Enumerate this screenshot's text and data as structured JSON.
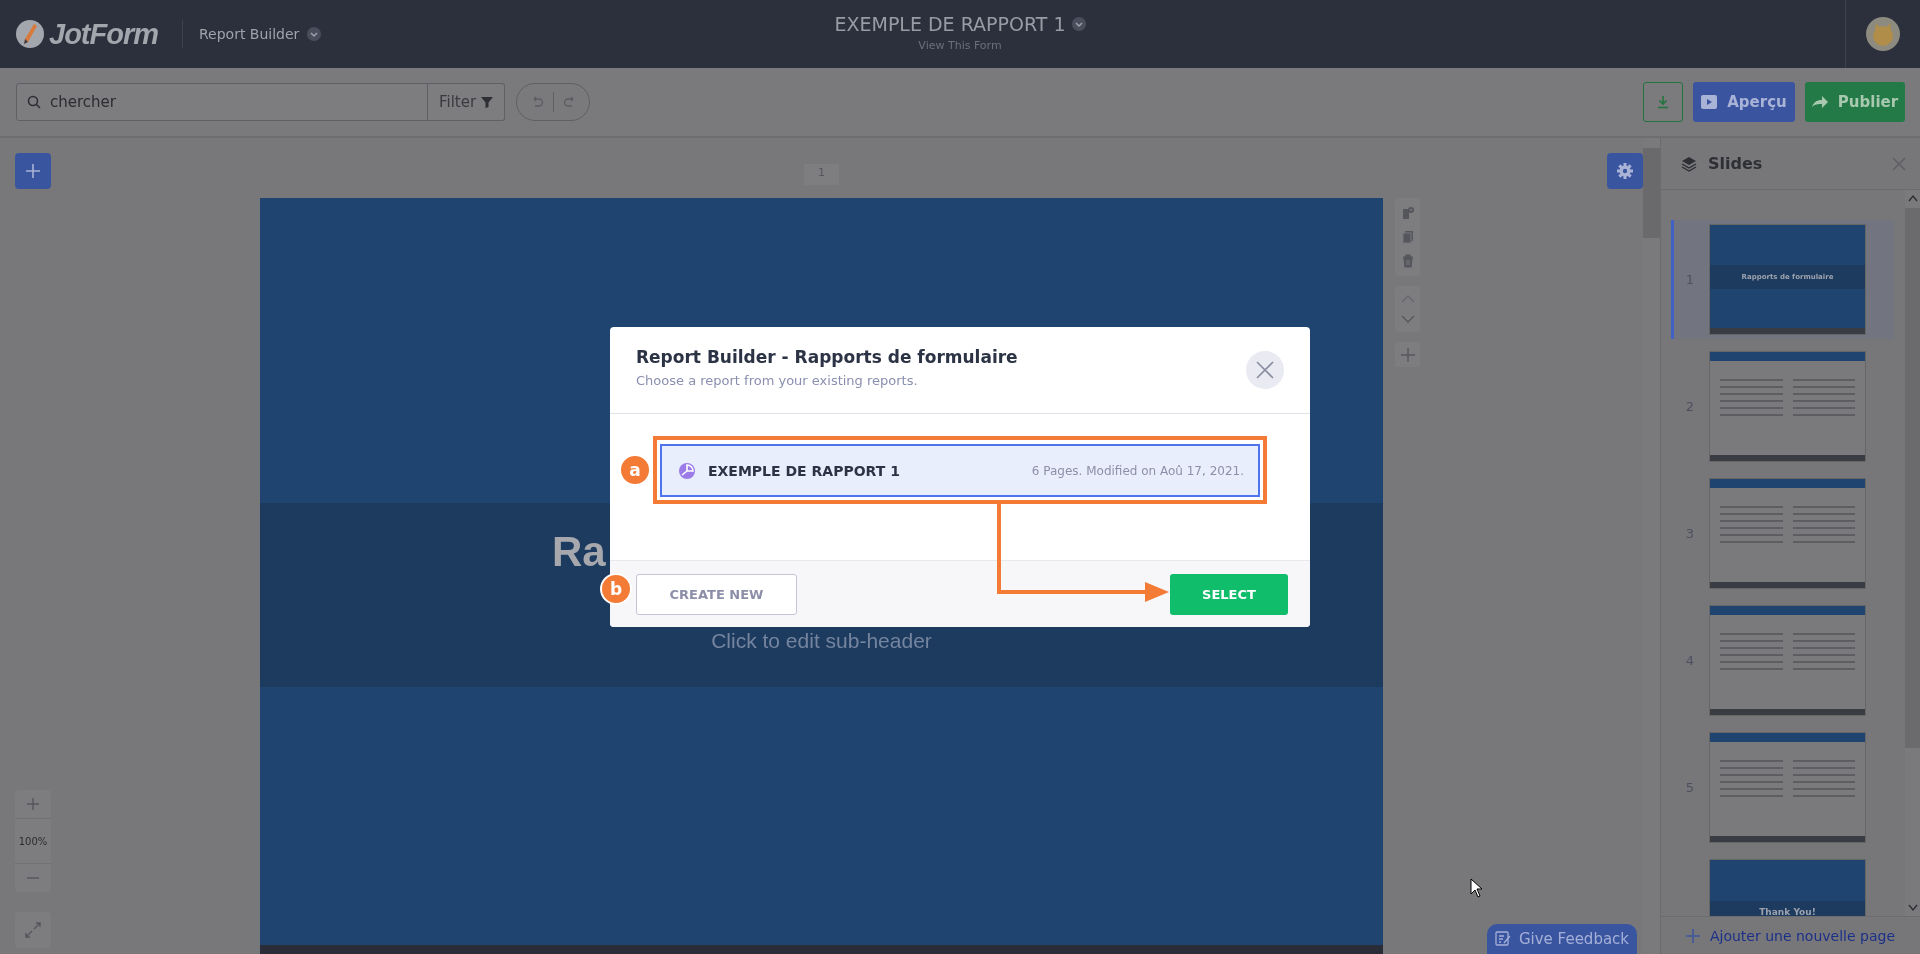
{
  "header": {
    "logo": "JotForm",
    "app_menu": "Report Builder",
    "form_title": "EXEMPLE DE RAPPORT 1",
    "form_link": "View This Form"
  },
  "toolbar": {
    "search": {
      "value": "chercher"
    },
    "filter_button": "Filter",
    "buttons": [
      {
        "kind": "download"
      },
      {
        "kind": "preview",
        "label": "Aperçu"
      },
      {
        "kind": "publish",
        "label": "Publier"
      }
    ]
  },
  "canvas": {
    "slide_number": "1",
    "zoom": "100%",
    "slide": {
      "title": "Ra",
      "subtitle": "Click to edit sub-header"
    }
  },
  "slides_panel": {
    "title": "Slides",
    "items": [
      {
        "number": "1",
        "kind": "cover",
        "selected": true,
        "heading": "Rapports de formulaire"
      },
      {
        "number": "2",
        "kind": "table",
        "selected": false
      },
      {
        "number": "3",
        "kind": "table",
        "selected": false
      },
      {
        "number": "4",
        "kind": "table",
        "selected": false
      },
      {
        "number": "5",
        "kind": "table",
        "selected": false
      },
      {
        "kind": "closing",
        "selected": false,
        "heading": "Thank You!"
      }
    ],
    "add_page": "Ajouter une nouvelle page"
  },
  "feedback_button": "Give Feedback",
  "modal": {
    "title": "Report Builder - Rapports de formulaire",
    "subtitle": "Choose a report from your existing reports.",
    "reports": [
      {
        "name": "EXEMPLE DE RAPPORT 1",
        "meta": "6 Pages. Modified on Aoû 17, 2021.",
        "selected": true
      }
    ],
    "buttons": [
      {
        "kind": "secondary",
        "label": "CREATE NEW"
      },
      {
        "kind": "primary",
        "label": "SELECT"
      }
    ]
  },
  "annotations": [
    {
      "label": "a"
    },
    {
      "label": "b"
    }
  ]
}
